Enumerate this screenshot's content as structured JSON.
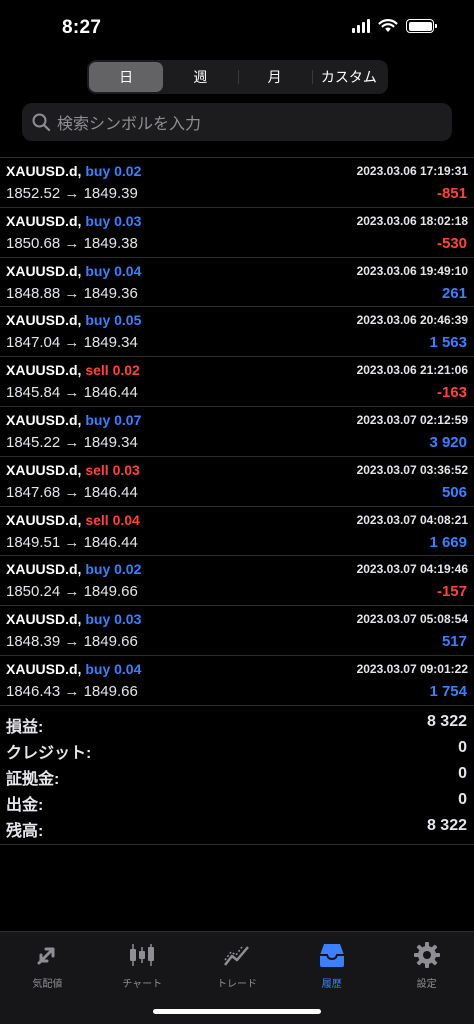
{
  "status": {
    "time": "8:27"
  },
  "tabs": [
    "日",
    "週",
    "月",
    "カスタム"
  ],
  "search": {
    "placeholder": "検索シンボルを入力"
  },
  "trades": [
    {
      "symbol": "XAUUSD.d,",
      "side": "buy",
      "volume": "0.02",
      "open": "1852.52",
      "close": "1849.39",
      "time": "2023.03.06 17:19:31",
      "profit": "-851"
    },
    {
      "symbol": "XAUUSD.d,",
      "side": "buy",
      "volume": "0.03",
      "open": "1850.68",
      "close": "1849.38",
      "time": "2023.03.06 18:02:18",
      "profit": "-530"
    },
    {
      "symbol": "XAUUSD.d,",
      "side": "buy",
      "volume": "0.04",
      "open": "1848.88",
      "close": "1849.36",
      "time": "2023.03.06 19:49:10",
      "profit": "261"
    },
    {
      "symbol": "XAUUSD.d,",
      "side": "buy",
      "volume": "0.05",
      "open": "1847.04",
      "close": "1849.34",
      "time": "2023.03.06 20:46:39",
      "profit": "1 563"
    },
    {
      "symbol": "XAUUSD.d,",
      "side": "sell",
      "volume": "0.02",
      "open": "1845.84",
      "close": "1846.44",
      "time": "2023.03.06 21:21:06",
      "profit": "-163"
    },
    {
      "symbol": "XAUUSD.d,",
      "side": "buy",
      "volume": "0.07",
      "open": "1845.22",
      "close": "1849.34",
      "time": "2023.03.07 02:12:59",
      "profit": "3 920"
    },
    {
      "symbol": "XAUUSD.d,",
      "side": "sell",
      "volume": "0.03",
      "open": "1847.68",
      "close": "1846.44",
      "time": "2023.03.07 03:36:52",
      "profit": "506"
    },
    {
      "symbol": "XAUUSD.d,",
      "side": "sell",
      "volume": "0.04",
      "open": "1849.51",
      "close": "1846.44",
      "time": "2023.03.07 04:08:21",
      "profit": "1 669"
    },
    {
      "symbol": "XAUUSD.d,",
      "side": "buy",
      "volume": "0.02",
      "open": "1850.24",
      "close": "1849.66",
      "time": "2023.03.07 04:19:46",
      "profit": "-157"
    },
    {
      "symbol": "XAUUSD.d,",
      "side": "buy",
      "volume": "0.03",
      "open": "1848.39",
      "close": "1849.66",
      "time": "2023.03.07 05:08:54",
      "profit": "517"
    },
    {
      "symbol": "XAUUSD.d,",
      "side": "buy",
      "volume": "0.04",
      "open": "1846.43",
      "close": "1849.66",
      "time": "2023.03.07 09:01:22",
      "profit": "1 754"
    }
  ],
  "arrow": "→",
  "summary": [
    {
      "label": "損益:",
      "value": "8 322"
    },
    {
      "label": "クレジット:",
      "value": "0"
    },
    {
      "label": "証拠金:",
      "value": "0"
    },
    {
      "label": "出金:",
      "value": "0"
    },
    {
      "label": "残高:",
      "value": "8 322"
    }
  ],
  "bottom_tabs": [
    {
      "label": "気配値",
      "icon": "quotes-arrows-icon"
    },
    {
      "label": "チャート",
      "icon": "candlestick-chart-icon"
    },
    {
      "label": "トレード",
      "icon": "trade-line-icon"
    },
    {
      "label": "履歴",
      "icon": "history-inbox-icon",
      "active": true
    },
    {
      "label": "設定",
      "icon": "settings-gear-icon"
    }
  ],
  "colors": {
    "buy": "#3d7fff",
    "sell": "#ff453a",
    "background": "#000000"
  }
}
